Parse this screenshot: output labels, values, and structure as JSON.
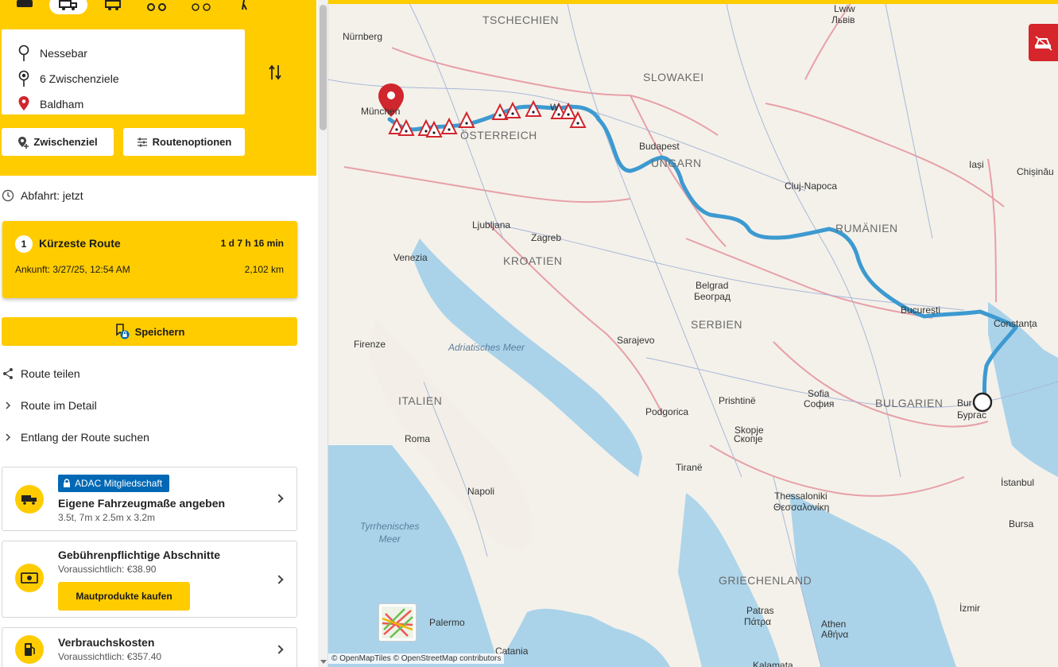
{
  "header": {
    "modes": [
      "car",
      "truck",
      "camper",
      "motorbike",
      "bicycle",
      "walking"
    ],
    "active_mode": "truck",
    "waypoints": [
      {
        "label": "Nessebar",
        "icon": "start-pin-icon"
      },
      {
        "label": "6 Zwischenziele",
        "icon": "via-pin-icon"
      },
      {
        "label": "Baldham",
        "icon": "destination-pin-icon"
      }
    ],
    "add_stop_label": "Zwischenziel",
    "route_options_label": "Routenoptionen"
  },
  "departure": {
    "label": "Abfahrt: jetzt"
  },
  "route": {
    "number": "1",
    "title": "Kürzeste Route",
    "duration": "1 d 7 h 16 min",
    "arrival": "Ankunft: 3/27/25, 12:54 AM",
    "distance": "2,102 km"
  },
  "save_label": "Speichern",
  "links": {
    "share": "Route teilen",
    "detail": "Route im Detail",
    "search_along": "Entlang der Route suchen"
  },
  "cards": {
    "vehicle": {
      "badge": "ADAC Mitgliedschaft",
      "title": "Eigene Fahrzeugmaße angeben",
      "sub": "3.5t, 7m x 2.5m x 3.2m"
    },
    "toll": {
      "title": "Gebührenpflichtige Abschnitte",
      "sub": "Voraussichtlich: €38.90",
      "button": "Mautprodukte kaufen"
    },
    "fuel": {
      "title": "Verbrauchskosten",
      "sub": "Voraussichtlich: €357.40"
    }
  },
  "map": {
    "countries": {
      "tschechien": "TSCHECHIEN",
      "slowakei": "SLOWAKEI",
      "oesterreich": "ÖSTERREICH",
      "ungarn": "UNGARN",
      "rumaenien": "RUMÄNIEN",
      "kroatien": "KROATIEN",
      "serbien": "SERBIEN",
      "italien": "ITALIEN",
      "bulgarien": "BULGARIEN",
      "griechenland": "GRIECHENLAND"
    },
    "cities": {
      "nuernberg": "Nürnberg",
      "muenchen": "München",
      "wien": "W",
      "budapest": "Budapest",
      "lwiw": "Lwiw",
      "lwiw_cyr": "Львів",
      "iasi": "Iași",
      "chisinau": "Chișinău",
      "cluj": "Cluj-Napoca",
      "ljubljana": "Ljubljana",
      "zagreb": "Zagreb",
      "venezia": "Venezia",
      "belgrad": "Belgrad",
      "belgrad_cyr": "Београд",
      "bucuresti": "București",
      "constanta": "Constanța",
      "firenze": "Firenze",
      "sarajevo": "Sarajevo",
      "roma": "Roma",
      "podgorica": "Podgorica",
      "prishtine": "Prishtinë",
      "sofia": "Sofia",
      "sofia_cyr": "София",
      "burgas": "Bur",
      "burgas_cyr": "Бургас",
      "skopje": "Skopje",
      "skopje_cyr": "Скопје",
      "tirane": "Tiranë",
      "napoli": "Napoli",
      "thessaloniki": "Thessaloniki",
      "thessaloniki_gr": "Θεσσαλονίκη",
      "istanbul": "İstanbul",
      "bursa": "Bursa",
      "izmir": "İzmir",
      "palermo": "Palermo",
      "patras": "Patras",
      "patras_gr": "Πάτρα",
      "athen": "Athen",
      "athen_gr": "Αθήνα",
      "catania": "Catania",
      "kalamata": "Kalamata"
    },
    "seas": {
      "adria": "Adriatisches Meer",
      "tyrrhen": "Tyrrhenisches\nMeer"
    },
    "attribution": "© OpenMapTiles © OpenStreetMap contributors",
    "route_color": "#3d9ad1"
  }
}
